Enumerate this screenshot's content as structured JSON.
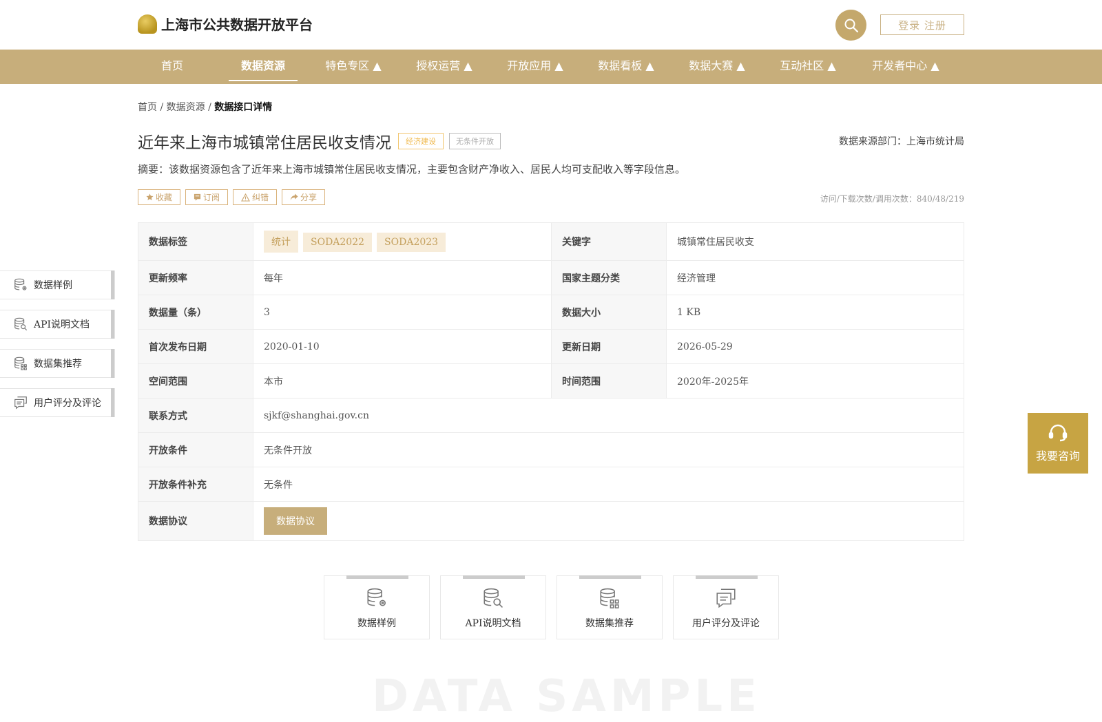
{
  "header": {
    "site_title": "上海市公共数据开放平台",
    "login_label": "登录 注册"
  },
  "nav": {
    "items": [
      {
        "label": "首页"
      },
      {
        "label": "数据资源"
      },
      {
        "label": "特色专区 ▲"
      },
      {
        "label": "授权运营 ▲"
      },
      {
        "label": "开放应用 ▲"
      },
      {
        "label": "数据看板 ▲"
      },
      {
        "label": "数据大赛 ▲"
      },
      {
        "label": "互动社区 ▲"
      },
      {
        "label": "开发者中心 ▲"
      }
    ],
    "active_index": 1
  },
  "breadcrumb": {
    "items": [
      "首页",
      "数据资源",
      "数据接口详情"
    ],
    "separator": "/"
  },
  "dataset": {
    "title": "近年来上海市城镇常住居民收支情况",
    "tag_category": "经济建设",
    "tag_open": "无条件开放",
    "source": "数据来源部门：上海市统计局",
    "abstract": "摘要：该数据资源包含了近年来上海市城镇常住居民收支情况，主要包含财产净收入、居民人均可支配收入等字段信息。",
    "visits": "访问/下载次数/调用次数：840/48/219"
  },
  "actions": [
    {
      "label": "收藏",
      "icon": "star-icon"
    },
    {
      "label": "订阅",
      "icon": "bookmark-icon"
    },
    {
      "label": "纠错",
      "icon": "warning-icon"
    },
    {
      "label": "分享",
      "icon": "share-icon"
    }
  ],
  "table": {
    "tags_label": "数据标签",
    "tags": [
      "统计",
      "SODA2022",
      "SODA2023"
    ],
    "keyword_label": "关键字",
    "keyword_value": "城镇常住居民收支",
    "rows_pair": [
      {
        "k1": "更新频率",
        "v1": "每年",
        "k2": "国家主题分类",
        "v2": "经济管理"
      },
      {
        "k1": "数据量（条）",
        "v1": "3",
        "k2": "数据大小",
        "v2": "1 KB"
      },
      {
        "k1": "首次发布日期",
        "v1": "2020-01-10",
        "k2": "更新日期",
        "v2": "2026-05-29"
      },
      {
        "k1": "空间范围",
        "v1": "本市",
        "k2": "时间范围",
        "v2": "2020年-2025年"
      }
    ],
    "rows_full": [
      {
        "k": "联系方式",
        "v": "sjkf@shanghai.gov.cn"
      },
      {
        "k": "开放条件",
        "v": "无条件开放"
      },
      {
        "k": "开放条件补充",
        "v": "无条件"
      }
    ],
    "protocol_label": "数据协议",
    "protocol_button": "数据协议"
  },
  "side_nav": [
    {
      "label": "数据样例",
      "icon": "database-gear-icon"
    },
    {
      "label": "API说明文档",
      "icon": "database-search-icon"
    },
    {
      "label": "数据集推荐",
      "icon": "database-grid-icon"
    },
    {
      "label": "用户评分及评论",
      "icon": "comments-icon"
    }
  ],
  "consult": {
    "label": "我要咨询",
    "icon": "headset-icon"
  },
  "cards": [
    {
      "label": "数据样例",
      "icon": "database-gear-icon"
    },
    {
      "label": "API说明文档",
      "icon": "database-search-icon"
    },
    {
      "label": "数据集推荐",
      "icon": "database-grid-icon"
    },
    {
      "label": "用户评分及评论",
      "icon": "comments-icon"
    }
  ],
  "watermark": "DATA SAMPLE",
  "colors": {
    "brand": "#c7ae7b",
    "consult": "#c7a443",
    "chip_bg": "#f7ecd9",
    "chip_text": "#c4a05d"
  }
}
